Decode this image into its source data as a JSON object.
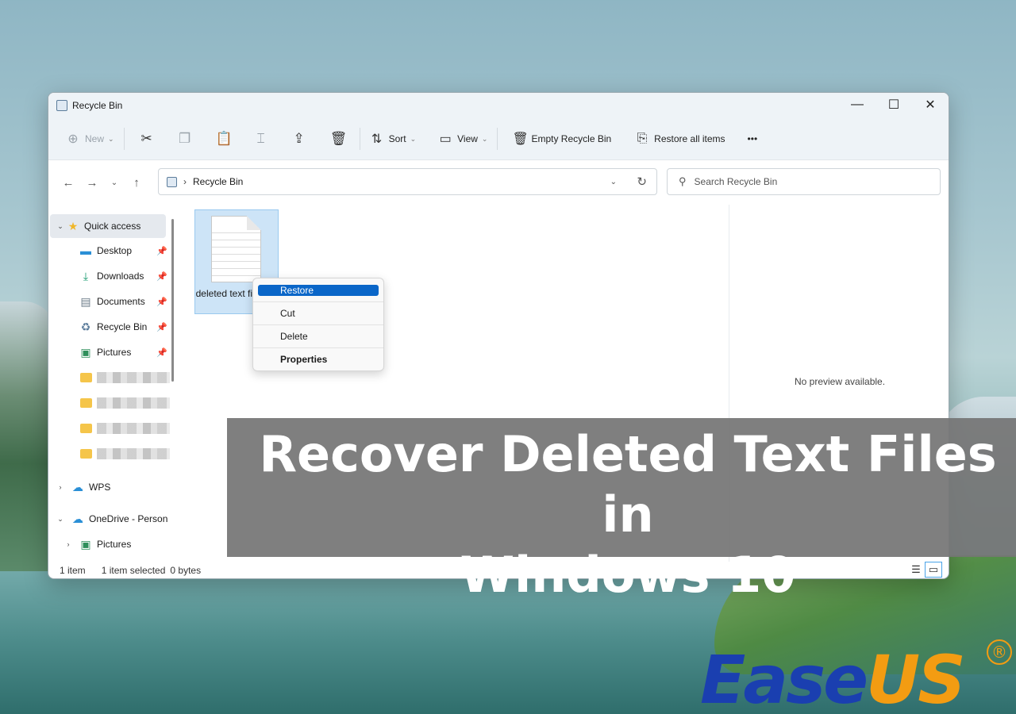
{
  "window": {
    "title": "Recycle Bin",
    "controls": {
      "minimize": "—",
      "maximize": "☐",
      "close": "✕"
    }
  },
  "commandbar": {
    "new_label": "New",
    "sort_label": "Sort",
    "view_label": "View",
    "empty_label": "Empty Recycle Bin",
    "restore_all_label": "Restore all items",
    "more_label": "•••"
  },
  "address": {
    "path": "Recycle Bin",
    "search_placeholder": "Search Recycle Bin"
  },
  "sidebar": {
    "quick_access": "Quick access",
    "items": [
      {
        "label": "Desktop"
      },
      {
        "label": "Downloads"
      },
      {
        "label": "Documents"
      },
      {
        "label": "Recycle Bin"
      },
      {
        "label": "Pictures"
      }
    ],
    "wps": "WPS",
    "onedrive": "OneDrive - Person",
    "onedrive_pictures": "Pictures"
  },
  "file": {
    "name": "deleted text files.txt"
  },
  "context_menu": {
    "restore": "Restore",
    "cut": "Cut",
    "delete": "Delete",
    "properties": "Properties"
  },
  "preview": {
    "text": "No preview available."
  },
  "status": {
    "count": "1 item",
    "selected": "1 item selected",
    "size": "0 bytes"
  },
  "banner": {
    "line1": "Recover Deleted Text Files in",
    "line2": "Windows 10"
  },
  "logo": {
    "part1": "Ease",
    "part2": "US",
    "reg": "®"
  }
}
